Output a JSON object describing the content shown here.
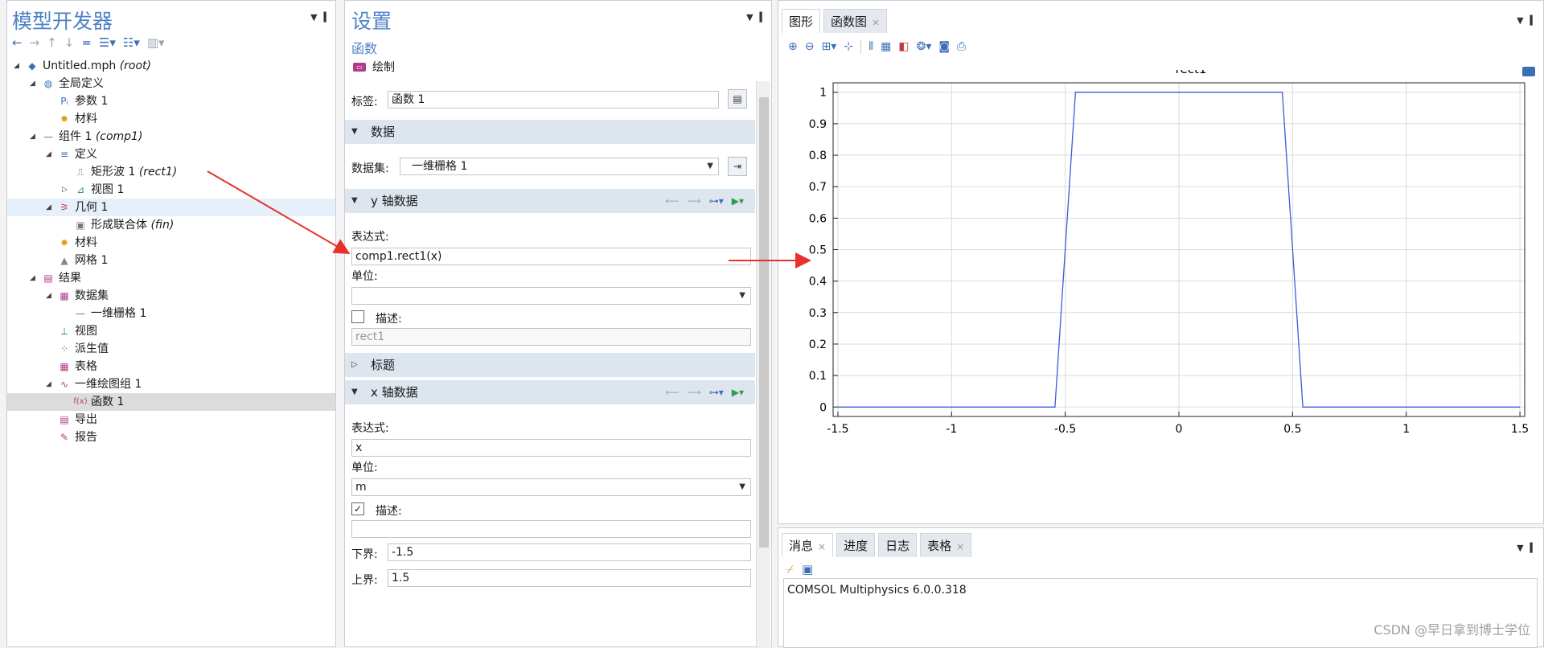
{
  "left": {
    "title": "模型开发器",
    "tree": [
      {
        "indent": 0,
        "twisty": "◢",
        "icon": "root-icon",
        "label": "Untitled.mph",
        "tag": "(root)"
      },
      {
        "indent": 1,
        "twisty": "◢",
        "icon": "globe-icon",
        "label": "全局定义",
        "tag": ""
      },
      {
        "indent": 2,
        "twisty": "",
        "icon": "params-icon",
        "label": "参数 1",
        "tag": ""
      },
      {
        "indent": 2,
        "twisty": "",
        "icon": "material-icon",
        "label": "材料",
        "tag": ""
      },
      {
        "indent": 1,
        "twisty": "◢",
        "icon": "component-icon",
        "label": "组件 1",
        "tag": "(comp1)"
      },
      {
        "indent": 2,
        "twisty": "◢",
        "icon": "definitions-icon",
        "label": "定义",
        "tag": ""
      },
      {
        "indent": 3,
        "twisty": "",
        "icon": "rect-wave-icon",
        "label": "矩形波 1",
        "tag": "(rect1)"
      },
      {
        "indent": 3,
        "twisty": "▷",
        "icon": "view-icon",
        "label": "视图 1",
        "tag": ""
      },
      {
        "indent": 2,
        "twisty": "◢",
        "icon": "geometry-icon",
        "label": "几何 1",
        "tag": ""
      },
      {
        "indent": 3,
        "twisty": "",
        "icon": "union-icon",
        "label": "形成联合体",
        "tag": "(fin)"
      },
      {
        "indent": 2,
        "twisty": "",
        "icon": "material-icon",
        "label": "材料",
        "tag": ""
      },
      {
        "indent": 2,
        "twisty": "",
        "icon": "mesh-icon",
        "label": "网格 1",
        "tag": ""
      },
      {
        "indent": 1,
        "twisty": "◢",
        "icon": "results-icon",
        "label": "结果",
        "tag": ""
      },
      {
        "indent": 2,
        "twisty": "◢",
        "icon": "dataset-icon",
        "label": "数据集",
        "tag": ""
      },
      {
        "indent": 3,
        "twisty": "",
        "icon": "grid1d-icon",
        "label": "一维栅格 1",
        "tag": ""
      },
      {
        "indent": 2,
        "twisty": "",
        "icon": "views-icon",
        "label": "视图",
        "tag": ""
      },
      {
        "indent": 2,
        "twisty": "",
        "icon": "derived-icon",
        "label": "派生值",
        "tag": ""
      },
      {
        "indent": 2,
        "twisty": "",
        "icon": "table-icon",
        "label": "表格",
        "tag": ""
      },
      {
        "indent": 2,
        "twisty": "◢",
        "icon": "plotgroup-icon",
        "label": "一维绘图组 1",
        "tag": ""
      },
      {
        "indent": 3,
        "twisty": "",
        "icon": "function-icon",
        "label": "函数 1",
        "tag": ""
      },
      {
        "indent": 2,
        "twisty": "",
        "icon": "export-icon",
        "label": "导出",
        "tag": ""
      },
      {
        "indent": 2,
        "twisty": "",
        "icon": "report-icon",
        "label": "报告",
        "tag": ""
      }
    ]
  },
  "settings": {
    "title": "设置",
    "subtitle": "函数",
    "plot_label": "绘制",
    "label_caption": "标签:",
    "label_value": "函数 1",
    "section_data": "数据",
    "dataset_caption": "数据集:",
    "dataset_value": "一维栅格 1",
    "section_y": "y 轴数据",
    "expr_caption": "表达式:",
    "y_expr": "comp1.rect1(x)",
    "unit_caption": "单位:",
    "y_unit": "",
    "desc_caption": "描述:",
    "y_desc_placeholder": "rect1",
    "section_title": "标题",
    "section_x": "x 轴数据",
    "x_expr": "x",
    "x_unit": "m",
    "lower_caption": "下界:",
    "lower_value": "-1.5",
    "upper_caption": "上界:",
    "upper_value": "1.5"
  },
  "graphics": {
    "tab_graphics": "图形",
    "tab_function": "函数图",
    "close_mark": "×"
  },
  "chart_data": {
    "type": "line",
    "title": "rect1",
    "xlabel": "",
    "ylabel": "",
    "xlim": [
      -1.5,
      1.5
    ],
    "ylim": [
      0,
      1
    ],
    "xticks": [
      -1.5,
      -1,
      -0.5,
      0,
      0.5,
      1,
      1.5
    ],
    "yticks": [
      0,
      0.1,
      0.2,
      0.3,
      0.4,
      0.5,
      0.6,
      0.7,
      0.8,
      0.9,
      1
    ],
    "grid": true,
    "series": [
      {
        "x": [
          -1.5,
          -0.545,
          -0.5,
          -0.455,
          0.455,
          0.5,
          0.545,
          1.5
        ],
        "y": [
          0,
          0,
          0.5,
          1,
          1,
          0.5,
          0,
          0
        ],
        "color": "#3b5bdb"
      }
    ]
  },
  "messages": {
    "tabs": [
      "消息",
      "进度",
      "日志",
      "表格"
    ],
    "text": "COMSOL Multiphysics 6.0.0.318",
    "watermark": "CSDN @早日拿到博士学位"
  },
  "colors": {
    "accent": "#4f82c5",
    "arrow": "#e8312a"
  }
}
